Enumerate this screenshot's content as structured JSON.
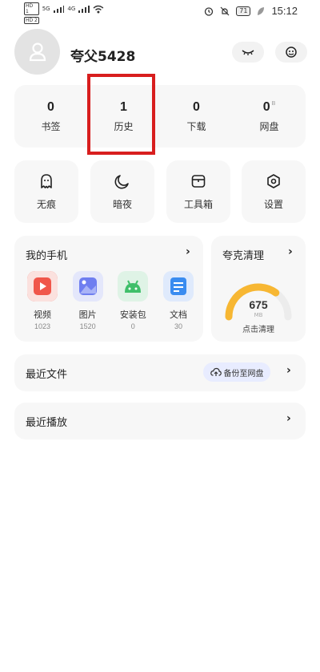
{
  "status_bar": {
    "sim1": "HD 1",
    "sim2": "HD 2",
    "net1": "5G",
    "net2": "4G",
    "battery": "71",
    "time": "15:12"
  },
  "profile": {
    "username": "夸父5428"
  },
  "stats": [
    {
      "value": "0",
      "label": "书签",
      "suffix": ""
    },
    {
      "value": "1",
      "label": "历史",
      "suffix": ""
    },
    {
      "value": "0",
      "label": "下载",
      "suffix": ""
    },
    {
      "value": "0",
      "label": "网盘",
      "suffix": "B"
    }
  ],
  "tools": [
    {
      "label": "无痕",
      "icon": "ghost-icon"
    },
    {
      "label": "暗夜",
      "icon": "moon-icon"
    },
    {
      "label": "工具箱",
      "icon": "toolbox-icon"
    },
    {
      "label": "设置",
      "icon": "settings-icon"
    }
  ],
  "my_phone": {
    "title": "我的手机",
    "files": [
      {
        "name": "视频",
        "count": "1023",
        "icon": "video-icon",
        "color": "#f0564a"
      },
      {
        "name": "图片",
        "count": "1520",
        "icon": "image-icon",
        "color": "#6f7ef0"
      },
      {
        "name": "安装包",
        "count": "0",
        "icon": "android-icon",
        "color": "#3fbf6a"
      },
      {
        "name": "文档",
        "count": "30",
        "icon": "document-icon",
        "color": "#3a8cf0"
      }
    ]
  },
  "cleaner": {
    "title": "夸克清理",
    "value": "675",
    "unit": "MB",
    "action": "点击清理",
    "gauge_fraction": 0.7,
    "gauge_color": "#f7b733"
  },
  "recent_files": {
    "title": "最近文件",
    "backup_label": "备份至网盘"
  },
  "recent_play": {
    "title": "最近播放"
  },
  "colors": {
    "highlight": "#d81e1e"
  }
}
